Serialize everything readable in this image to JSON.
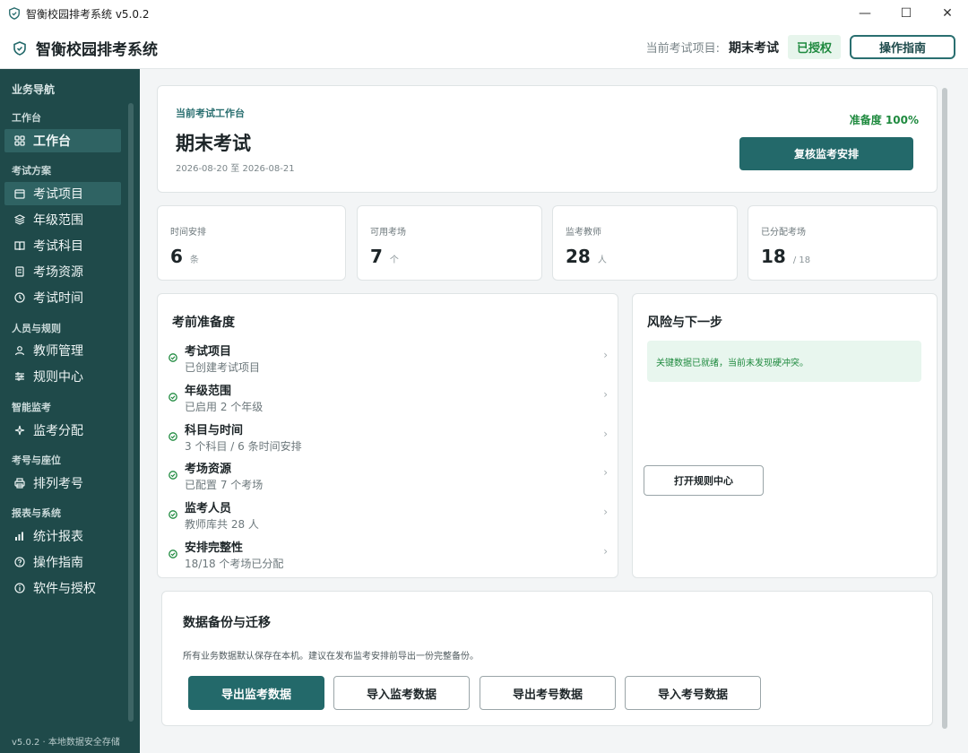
{
  "window": {
    "title": "智衡校园排考系统 v5.0.2",
    "controls": {
      "minimize": "—",
      "maximize": "☐",
      "close": "✕"
    }
  },
  "header": {
    "brand": "智衡校园排考系统",
    "project_label": "当前考试项目:",
    "project_name": "期末考试",
    "license": "已授权",
    "guide_button": "操作指南"
  },
  "sidebar": {
    "title": "业务导航",
    "groups": [
      {
        "label": "工作台",
        "items": [
          {
            "label": "工作台",
            "icon": "grid-icon",
            "active": true
          }
        ]
      },
      {
        "label": "考试方案",
        "items": [
          {
            "label": "考试项目",
            "icon": "calendar-icon",
            "active": true
          },
          {
            "label": "年级范围",
            "icon": "layers-icon"
          },
          {
            "label": "考试科目",
            "icon": "book-icon"
          },
          {
            "label": "考场资源",
            "icon": "room-icon"
          },
          {
            "label": "考试时间",
            "icon": "clock-icon"
          }
        ]
      },
      {
        "label": "人员与规则",
        "items": [
          {
            "label": "教师管理",
            "icon": "user-icon"
          },
          {
            "label": "规则中心",
            "icon": "sliders-icon"
          }
        ]
      },
      {
        "label": "智能监考",
        "items": [
          {
            "label": "监考分配",
            "icon": "sparkle-icon"
          }
        ]
      },
      {
        "label": "考号与座位",
        "items": [
          {
            "label": "排列考号",
            "icon": "printer-icon"
          }
        ]
      },
      {
        "label": "报表与系统",
        "items": [
          {
            "label": "统计报表",
            "icon": "bar-chart-icon"
          },
          {
            "label": "操作指南",
            "icon": "help-icon"
          },
          {
            "label": "软件与授权",
            "icon": "info-icon"
          }
        ]
      }
    ],
    "footer": "v5.0.2 · 本地数据安全存储"
  },
  "hero": {
    "tag": "当前考试工作台",
    "title": "期末考试",
    "date_range": "2026-08-20 至 2026-08-21",
    "readiness": "准备度 100%",
    "review_button": "复核监考安排"
  },
  "stats": [
    {
      "label": "时间安排",
      "value": "6",
      "unit": "条"
    },
    {
      "label": "可用考场",
      "value": "7",
      "unit": "个"
    },
    {
      "label": "监考教师",
      "value": "28",
      "unit": "人"
    },
    {
      "label": "已分配考场",
      "value": "18",
      "unit": "/ 18"
    }
  ],
  "readiness": {
    "title": "考前准备度",
    "items": [
      {
        "title": "考试项目",
        "sub": "已创建考试项目"
      },
      {
        "title": "年级范围",
        "sub": "已启用 2 个年级"
      },
      {
        "title": "科目与时间",
        "sub": "3 个科目 / 6 条时间安排"
      },
      {
        "title": "考场资源",
        "sub": "已配置 7 个考场"
      },
      {
        "title": "监考人员",
        "sub": "教师库共 28 人"
      },
      {
        "title": "安排完整性",
        "sub": "18/18 个考场已分配"
      }
    ],
    "arrow": "›"
  },
  "risk": {
    "title": "风险与下一步",
    "note": "关键数据已就绪，当前未发现硬冲突。",
    "button": "打开规则中心"
  },
  "backup": {
    "title": "数据备份与迁移",
    "desc": "所有业务数据默认保存在本机。建议在发布监考安排前导出一份完整备份。",
    "buttons": [
      "导出监考数据",
      "导入监考数据",
      "导出考号数据",
      "导入考号数据"
    ]
  },
  "colors": {
    "primary": "#23696a",
    "sidebar": "#1f4a4a",
    "success": "#1f8a3f"
  }
}
